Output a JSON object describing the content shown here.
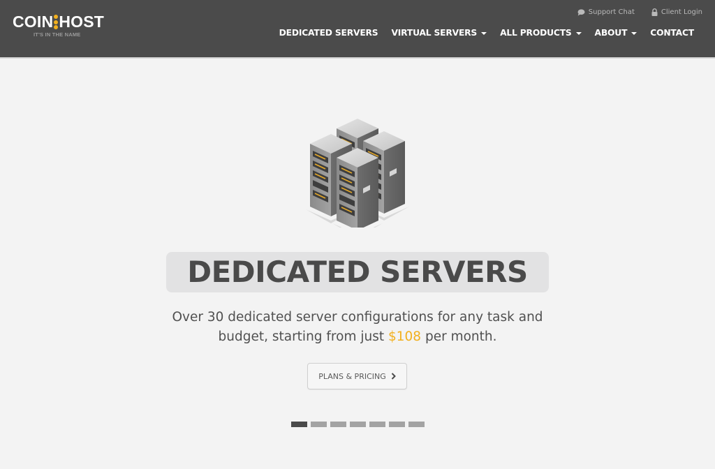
{
  "brand": {
    "name_left": "COIN",
    "name_right": "HOST",
    "tagline": "IT'S IN THE NAME",
    "accent_color": "#f2b01e"
  },
  "top_links": [
    {
      "label": "Support Chat",
      "icon": "chat-bubble-icon"
    },
    {
      "label": "Client Login",
      "icon": "lock-icon"
    }
  ],
  "nav": {
    "items": [
      {
        "label": "DEDICATED SERVERS",
        "has_dropdown": false
      },
      {
        "label": "VIRTUAL SERVERS",
        "has_dropdown": true
      },
      {
        "label": "ALL PRODUCTS",
        "has_dropdown": true
      },
      {
        "label": "ABOUT",
        "has_dropdown": true
      },
      {
        "label": "CONTACT",
        "has_dropdown": false
      }
    ]
  },
  "hero": {
    "icon": "server-racks-icon",
    "title": "DEDICATED SERVERS",
    "subtitle_before": "Over 30 dedicated server configurations for any task and budget, starting from just ",
    "price": "$108",
    "subtitle_after": " per month.",
    "cta_label": "PLANS & PRICING",
    "cta_icon": "chevron-right-icon"
  },
  "carousel": {
    "slide_count": 7,
    "active_index": 0
  }
}
